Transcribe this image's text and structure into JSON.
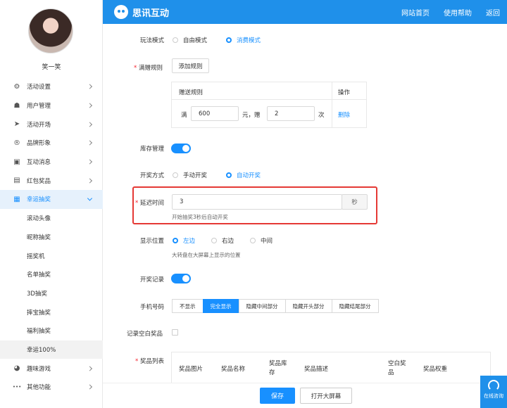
{
  "user": {
    "name": "笑一笑"
  },
  "menu": [
    {
      "label": "活动设置",
      "icon": "gear-icon",
      "glyph": "⚙"
    },
    {
      "label": "用户管理",
      "icon": "user-icon",
      "glyph": "☗"
    },
    {
      "label": "活动开场",
      "icon": "send-icon",
      "glyph": "➤"
    },
    {
      "label": "品牌形象",
      "icon": "registered-icon",
      "glyph": "®"
    },
    {
      "label": "互动消息",
      "icon": "message-icon",
      "glyph": "▣"
    },
    {
      "label": "红包奖品",
      "icon": "gift-icon",
      "glyph": "▤"
    },
    {
      "label": "幸运抽奖",
      "icon": "lottery-icon",
      "glyph": "▦"
    }
  ],
  "submenu": [
    "滚动头像",
    "昵称抽奖",
    "摇奖机",
    "名单抽奖",
    "3D抽奖",
    "摔宝抽奖",
    "福利抽奖",
    "幸运100%"
  ],
  "menu_bottom": [
    {
      "label": "趣味游戏",
      "icon": "game-icon",
      "glyph": "◕"
    },
    {
      "label": "其他功能",
      "icon": "more-icon",
      "glyph": "•••"
    }
  ],
  "header": {
    "brand": "思讯互动",
    "nav": [
      "网站首页",
      "使用帮助",
      "返回"
    ]
  },
  "form": {
    "play_mode": {
      "label": "玩法模式",
      "options": [
        "自由模式",
        "消费模式"
      ]
    },
    "gift_rule": {
      "label": "满赠规则",
      "add_button": "添加规则",
      "col_rule": "赠送规则",
      "col_op": "操作",
      "prefix": "满",
      "amount": "600",
      "unit": "元，赠",
      "count": "2",
      "suffix": "次",
      "delete": "删除"
    },
    "stock": {
      "label": "库存管理"
    },
    "draw_mode": {
      "label": "开奖方式",
      "options": [
        "手动开奖",
        "自动开奖"
      ]
    },
    "delay": {
      "label": "延迟时间",
      "value": "3",
      "unit": "秒",
      "hint": "开始抽奖3秒后自动开奖"
    },
    "position": {
      "label": "显示位置",
      "options": [
        "左边",
        "右边",
        "中间"
      ],
      "hint": "大转盘在大屏幕上显示的位置"
    },
    "record": {
      "label": "开奖记录"
    },
    "phone": {
      "label": "手机号码",
      "options": [
        "不显示",
        "完全显示",
        "隐藏中间部分",
        "隐藏开头部分",
        "隐藏结尾部分"
      ]
    },
    "empty_prize": {
      "label": "记录空白奖品"
    },
    "prize_list": {
      "label": "奖品列表",
      "cols": [
        "奖品图片",
        "奖品名称",
        "奖品库存",
        "奖品描述",
        "空白奖品",
        "奖品权重"
      ]
    }
  },
  "footer": {
    "save": "保存",
    "open": "打开大屏幕"
  },
  "consult": {
    "label": "在线咨询"
  },
  "colors": {
    "primary": "#1890ff",
    "header": "#1f90ea",
    "highlight": "#e53935"
  }
}
